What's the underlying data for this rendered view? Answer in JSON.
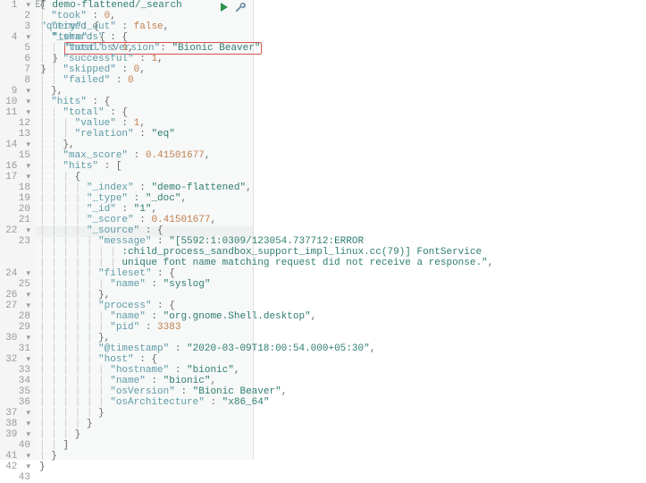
{
  "request": {
    "method": "GET",
    "path": "demo-flattened/_search",
    "body_keys": {
      "query": "\"query\"",
      "term": "\"term\"",
      "field": "\"host.osVersion\"",
      "value": "\"Bionic Beaver\""
    }
  },
  "icons": {
    "run": "run-icon",
    "wrench": "wrench-icon"
  },
  "response": {
    "lines": [
      {
        "n": "1",
        "fold": "▾",
        "t": [
          [
            "p",
            "{"
          ]
        ]
      },
      {
        "n": "2",
        "t": [
          [
            "i",
            "  "
          ],
          [
            "k",
            "\"took\""
          ],
          [
            "p",
            " : "
          ],
          [
            "n",
            "0"
          ],
          [
            "p",
            ","
          ]
        ]
      },
      {
        "n": "3",
        "t": [
          [
            "i",
            "  "
          ],
          [
            "k",
            "\"timed_out\""
          ],
          [
            "p",
            " : "
          ],
          [
            "b",
            "false"
          ],
          [
            "p",
            ","
          ]
        ]
      },
      {
        "n": "4",
        "fold": "▾",
        "t": [
          [
            "i",
            "  "
          ],
          [
            "k",
            "\"_shards\""
          ],
          [
            "p",
            " : {"
          ]
        ]
      },
      {
        "n": "5",
        "t": [
          [
            "i",
            "    "
          ],
          [
            "k",
            "\"total\""
          ],
          [
            "p",
            " : "
          ],
          [
            "n",
            "1"
          ],
          [
            "p",
            ","
          ]
        ]
      },
      {
        "n": "6",
        "t": [
          [
            "i",
            "    "
          ],
          [
            "k",
            "\"successful\""
          ],
          [
            "p",
            " : "
          ],
          [
            "n",
            "1"
          ],
          [
            "p",
            ","
          ]
        ]
      },
      {
        "n": "7",
        "t": [
          [
            "i",
            "    "
          ],
          [
            "k",
            "\"skipped\""
          ],
          [
            "p",
            " : "
          ],
          [
            "n",
            "0"
          ],
          [
            "p",
            ","
          ]
        ]
      },
      {
        "n": "8",
        "t": [
          [
            "i",
            "    "
          ],
          [
            "k",
            "\"failed\""
          ],
          [
            "p",
            " : "
          ],
          [
            "n",
            "0"
          ]
        ]
      },
      {
        "n": "9",
        "fold": "▾",
        "t": [
          [
            "i",
            "  "
          ],
          [
            "p",
            "},"
          ]
        ]
      },
      {
        "n": "10",
        "fold": "▾",
        "t": [
          [
            "i",
            "  "
          ],
          [
            "k",
            "\"hits\""
          ],
          [
            "p",
            " : {"
          ]
        ]
      },
      {
        "n": "11",
        "fold": "▾",
        "t": [
          [
            "i",
            "    "
          ],
          [
            "k",
            "\"total\""
          ],
          [
            "p",
            " : {"
          ]
        ]
      },
      {
        "n": "12",
        "t": [
          [
            "i",
            "      "
          ],
          [
            "k",
            "\"value\""
          ],
          [
            "p",
            " : "
          ],
          [
            "n",
            "1"
          ],
          [
            "p",
            ","
          ]
        ]
      },
      {
        "n": "13",
        "t": [
          [
            "i",
            "      "
          ],
          [
            "k",
            "\"relation\""
          ],
          [
            "p",
            " : "
          ],
          [
            "s",
            "\"eq\""
          ]
        ]
      },
      {
        "n": "14",
        "fold": "▾",
        "t": [
          [
            "i",
            "    "
          ],
          [
            "p",
            "},"
          ]
        ]
      },
      {
        "n": "15",
        "t": [
          [
            "i",
            "    "
          ],
          [
            "k",
            "\"max_score\""
          ],
          [
            "p",
            " : "
          ],
          [
            "n",
            "0.41501677"
          ],
          [
            "p",
            ","
          ]
        ]
      },
      {
        "n": "16",
        "fold": "▾",
        "t": [
          [
            "i",
            "    "
          ],
          [
            "k",
            "\"hits\""
          ],
          [
            "p",
            " : ["
          ]
        ]
      },
      {
        "n": "17",
        "fold": "▾",
        "t": [
          [
            "i",
            "      "
          ],
          [
            "p",
            "{"
          ]
        ]
      },
      {
        "n": "18",
        "t": [
          [
            "i",
            "        "
          ],
          [
            "k",
            "\"_index\""
          ],
          [
            "p",
            " : "
          ],
          [
            "s",
            "\"demo-flattened\""
          ],
          [
            "p",
            ","
          ]
        ]
      },
      {
        "n": "19",
        "t": [
          [
            "i",
            "        "
          ],
          [
            "k",
            "\"_type\""
          ],
          [
            "p",
            " : "
          ],
          [
            "s",
            "\"_doc\""
          ],
          [
            "p",
            ","
          ]
        ]
      },
      {
        "n": "20",
        "t": [
          [
            "i",
            "        "
          ],
          [
            "k",
            "\"_id\""
          ],
          [
            "p",
            " : "
          ],
          [
            "s",
            "\"1\""
          ],
          [
            "p",
            ","
          ]
        ]
      },
      {
        "n": "21",
        "t": [
          [
            "i",
            "        "
          ],
          [
            "k",
            "\"_score\""
          ],
          [
            "p",
            " : "
          ],
          [
            "n",
            "0.41501677"
          ],
          [
            "p",
            ","
          ]
        ]
      },
      {
        "n": "22",
        "fold": "▾",
        "t": [
          [
            "i",
            "        "
          ],
          [
            "k",
            "\"_source\""
          ],
          [
            "p",
            " : {"
          ]
        ]
      },
      {
        "n": "23",
        "t": [
          [
            "i",
            "          "
          ],
          [
            "k",
            "\"message\""
          ],
          [
            "p",
            " : "
          ],
          [
            "s",
            "\"[5592:1:0309/123054.737712:ERROR"
          ]
        ]
      },
      {
        "n": "",
        "t": [
          [
            "i",
            "              "
          ],
          [
            "s",
            ":child_process_sandbox_support_impl_linux.cc(79)] FontService"
          ]
        ]
      },
      {
        "n": "",
        "t": [
          [
            "i",
            "              "
          ],
          [
            "s",
            "unique font name matching request did not receive a response.\""
          ],
          [
            "p",
            ","
          ]
        ]
      },
      {
        "n": "24",
        "fold": "▾",
        "t": [
          [
            "i",
            "          "
          ],
          [
            "k",
            "\"fileset\""
          ],
          [
            "p",
            " : {"
          ]
        ]
      },
      {
        "n": "25",
        "t": [
          [
            "i",
            "            "
          ],
          [
            "k",
            "\"name\""
          ],
          [
            "p",
            " : "
          ],
          [
            "s",
            "\"syslog\""
          ]
        ]
      },
      {
        "n": "26",
        "fold": "▾",
        "t": [
          [
            "i",
            "          "
          ],
          [
            "p",
            "},"
          ]
        ]
      },
      {
        "n": "27",
        "fold": "▾",
        "t": [
          [
            "i",
            "          "
          ],
          [
            "k",
            "\"process\""
          ],
          [
            "p",
            " : {"
          ]
        ]
      },
      {
        "n": "28",
        "t": [
          [
            "i",
            "            "
          ],
          [
            "k",
            "\"name\""
          ],
          [
            "p",
            " : "
          ],
          [
            "s",
            "\"org.gnome.Shell.desktop\""
          ],
          [
            "p",
            ","
          ]
        ]
      },
      {
        "n": "29",
        "t": [
          [
            "i",
            "            "
          ],
          [
            "k",
            "\"pid\""
          ],
          [
            "p",
            " : "
          ],
          [
            "n",
            "3383"
          ]
        ]
      },
      {
        "n": "30",
        "fold": "▾",
        "t": [
          [
            "i",
            "          "
          ],
          [
            "p",
            "},"
          ]
        ]
      },
      {
        "n": "31",
        "t": [
          [
            "i",
            "          "
          ],
          [
            "k",
            "\"@timestamp\""
          ],
          [
            "p",
            " : "
          ],
          [
            "s",
            "\"2020-03-09T18:00:54.000+05:30\""
          ],
          [
            "p",
            ","
          ]
        ]
      },
      {
        "n": "32",
        "fold": "▾",
        "t": [
          [
            "i",
            "          "
          ],
          [
            "k",
            "\"host\""
          ],
          [
            "p",
            " : {"
          ]
        ]
      },
      {
        "n": "33",
        "t": [
          [
            "i",
            "            "
          ],
          [
            "k",
            "\"hostname\""
          ],
          [
            "p",
            " : "
          ],
          [
            "s",
            "\"bionic\""
          ],
          [
            "p",
            ","
          ]
        ]
      },
      {
        "n": "34",
        "t": [
          [
            "i",
            "            "
          ],
          [
            "k",
            "\"name\""
          ],
          [
            "p",
            " : "
          ],
          [
            "s",
            "\"bionic\""
          ],
          [
            "p",
            ","
          ]
        ]
      },
      {
        "n": "35",
        "t": [
          [
            "i",
            "            "
          ],
          [
            "k",
            "\"osVersion\""
          ],
          [
            "p",
            " : "
          ],
          [
            "s",
            "\"Bionic Beaver\""
          ],
          [
            "p",
            ","
          ]
        ]
      },
      {
        "n": "36",
        "t": [
          [
            "i",
            "            "
          ],
          [
            "k",
            "\"osArchitecture\""
          ],
          [
            "p",
            " : "
          ],
          [
            "s",
            "\"x86_64\""
          ]
        ]
      },
      {
        "n": "37",
        "fold": "▾",
        "t": [
          [
            "i",
            "          "
          ],
          [
            "p",
            "}"
          ]
        ]
      },
      {
        "n": "38",
        "fold": "▾",
        "t": [
          [
            "i",
            "        "
          ],
          [
            "p",
            "}"
          ]
        ]
      },
      {
        "n": "39",
        "fold": "▾",
        "t": [
          [
            "i",
            "      "
          ],
          [
            "p",
            "}"
          ]
        ]
      },
      {
        "n": "40",
        "t": [
          [
            "i",
            "    "
          ],
          [
            "p",
            "]"
          ]
        ]
      },
      {
        "n": "41",
        "fold": "▾",
        "t": [
          [
            "i",
            "  "
          ],
          [
            "p",
            "}"
          ]
        ]
      },
      {
        "n": "42",
        "fold": "▾",
        "t": [
          [
            "p",
            "}"
          ]
        ]
      },
      {
        "n": "43",
        "t": []
      }
    ]
  }
}
